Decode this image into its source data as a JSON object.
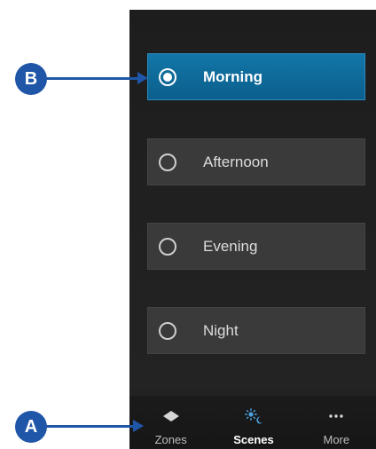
{
  "callouts": {
    "b": "B",
    "a": "A"
  },
  "scenes": [
    {
      "label": "Morning",
      "selected": true
    },
    {
      "label": "Afternoon",
      "selected": false
    },
    {
      "label": "Evening",
      "selected": false
    },
    {
      "label": "Night",
      "selected": false
    }
  ],
  "tabs": [
    {
      "label": "Zones",
      "icon": "diamond-icon",
      "active": false
    },
    {
      "label": "Scenes",
      "icon": "sun-moon-icon",
      "active": true
    },
    {
      "label": "More",
      "icon": "ellipsis-icon",
      "active": false
    }
  ],
  "colors": {
    "selected_scene": "#0b6a9b",
    "scenes_icon_accent": "#4aa3e0",
    "callout": "#1f56a8"
  }
}
